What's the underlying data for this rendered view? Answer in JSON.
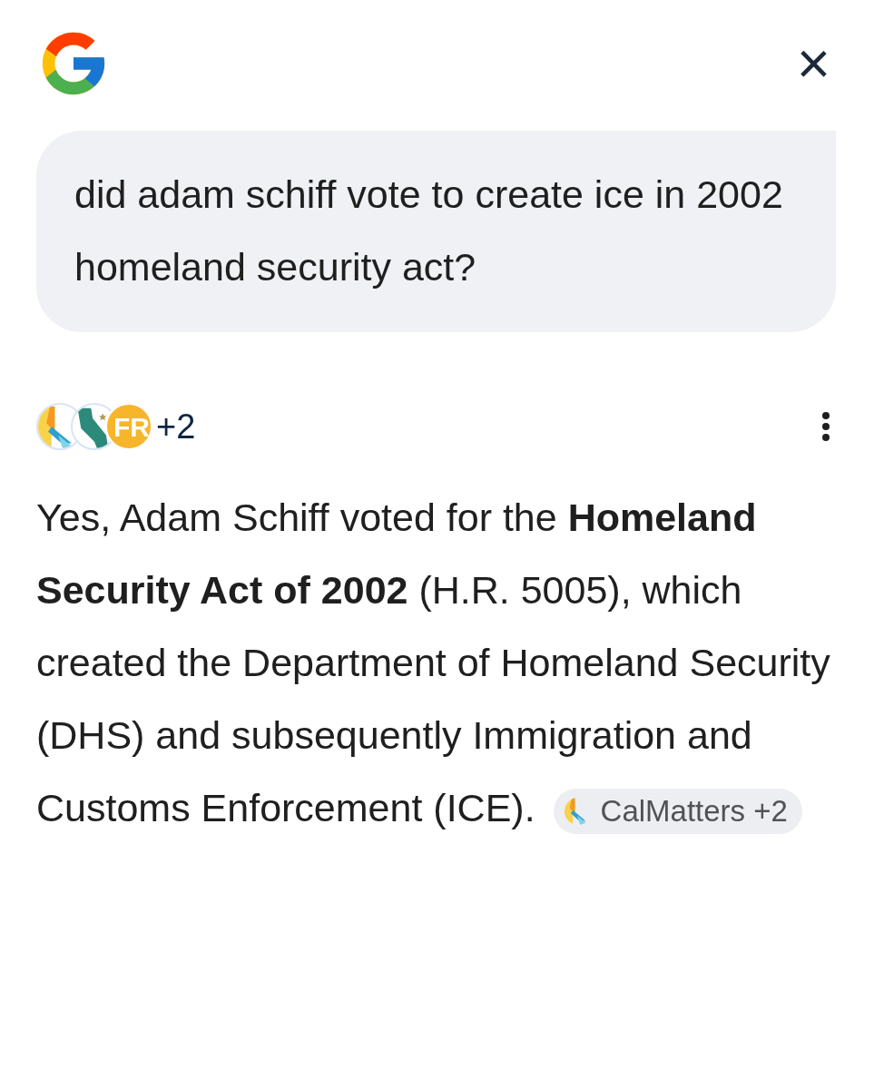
{
  "header": {
    "close_icon": "×"
  },
  "query": {
    "text": "did adam schiff vote to create ice in 2002 homeland security act?"
  },
  "sources": {
    "logos": [
      {
        "kind": "calmatters"
      },
      {
        "kind": "state"
      },
      {
        "kind": "initials",
        "text": "FR"
      }
    ],
    "more": "+2"
  },
  "answer": {
    "text": "Yes, Adam Schiff voted for the **Homeland Security Act of 2002** (H.R. 5005), which created the Department of Homeland Security (DHS) and subsequently Immigration and Customs Enforcement (ICE).",
    "citation": {
      "label": "CalMatters +2"
    }
  }
}
